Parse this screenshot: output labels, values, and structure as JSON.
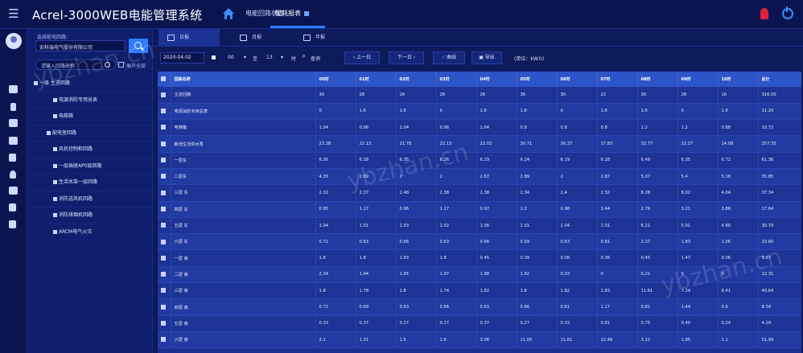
{
  "header": {
    "app_title": "Acrel-3000WEB电能管理系统",
    "tabs": [
      {
        "label": "电能回路状态"
      },
      {
        "label": "能耗报表"
      }
    ]
  },
  "sidebar_icons": [
    "avatar",
    "monitor-icon",
    "gauge-icon",
    "folder-icon",
    "chart-icon",
    "document-icon",
    "user-icon",
    "tools-icon",
    "edit-icon",
    "settings-icon"
  ],
  "tree": {
    "select_label": "选择配电回路：",
    "select_value": "安科瑞电气股份有限公司",
    "name_placeholder": "请输入回路名称",
    "check_label": "展开全部",
    "items": [
      {
        "label": "一级 主进回路"
      },
      {
        "label": "电源消防专用总表"
      },
      {
        "label": "电梯箱"
      },
      {
        "label": "配电室回路"
      },
      {
        "label": "风机控制柜回路"
      },
      {
        "label": "一层插座AP0层回路"
      },
      {
        "label": "生活水泵一层回路"
      },
      {
        "label": "消防送风机回路"
      },
      {
        "label": "消防排烟机回路"
      },
      {
        "label": "ARCM电气火灾"
      }
    ]
  },
  "subtabs": [
    {
      "label": "日报"
    },
    {
      "label": "月报"
    },
    {
      "label": "年报"
    }
  ],
  "toolbar": {
    "date": "2020-04-02",
    "hour_from": "00",
    "hour_to": "13",
    "hour_unit": "时",
    "to_label": "至",
    "query_label": "查询",
    "prev_label": "上一日",
    "next_label": "下一日",
    "chart_label": "曲线",
    "export_label": "导出",
    "unit_label": "(单位：kW.h)"
  },
  "table": {
    "headers": [
      "回路名称",
      "00时",
      "01时",
      "02时",
      "03时",
      "04时",
      "05时",
      "06时",
      "07时",
      "08时",
      "09时",
      "10时",
      "总计"
    ],
    "rows": [
      [
        "主进回路",
        "30",
        "28",
        "26",
        "28",
        "26",
        "36",
        "30",
        "22",
        "30",
        "28",
        "16",
        "316.00"
      ],
      [
        "电源消防专用总表",
        "0",
        "1.6",
        "1.6",
        "0",
        "1.6",
        "1.6",
        "0",
        "1.6",
        "1.6",
        "0",
        "1.6",
        "11.20"
      ],
      [
        "电梯箱",
        "1.04",
        "0.96",
        "1.04",
        "0.96",
        "1.04",
        "0.8",
        "0.8",
        "0.8",
        "1.2",
        "1.2",
        "0.88",
        "10.72"
      ],
      [
        "新增生活供水泵",
        "23.38",
        "22.13",
        "21.78",
        "22.13",
        "22.02",
        "30.71",
        "26.37",
        "17.83",
        "32.77",
        "22.27",
        "14.08",
        "257.35"
      ],
      [
        "一层东",
        "6.36",
        "6.38",
        "6.35",
        "6.26",
        "6.29",
        "6.24",
        "6.19",
        "6.28",
        "6.49",
        "6.35",
        "6.72",
        "61.36"
      ],
      [
        "二层东",
        "4.35",
        "2.69",
        "2",
        "2",
        "2.67",
        "2.89",
        "2",
        "2.87",
        "5.07",
        "5.4",
        "5.16",
        "35.85"
      ],
      [
        "三层 东",
        "2.32",
        "2.37",
        "2.48",
        "2.38",
        "2.38",
        "2.34",
        "2.4",
        "2.32",
        "8.28",
        "8.02",
        "4.04",
        "37.34"
      ],
      [
        "四层 东",
        "0.95",
        "1.17",
        "0.96",
        "1.17",
        "0.97",
        "1.2",
        "0.98",
        "1.44",
        "2.79",
        "3.21",
        "3.86",
        "17.64"
      ],
      [
        "五层 东",
        "1.04",
        "1.01",
        "1.03",
        "1.02",
        "1.06",
        "1.01",
        "1.04",
        "1.01",
        "6.21",
        "5.91",
        "4.80",
        "30.79"
      ],
      [
        "六层 东",
        "0.72",
        "0.63",
        "0.66",
        "0.63",
        "0.66",
        "0.59",
        "0.63",
        "0.81",
        "2.37",
        "1.83",
        "1.06",
        "10.60"
      ],
      [
        "一层 南",
        "1.8",
        "1.8",
        "1.83",
        "1.8",
        "0.45",
        "0.39",
        "0.06",
        "0.36",
        "0.45",
        "1.47",
        "0.06",
        "9.87"
      ],
      [
        "二层 南",
        "2.34",
        "1.94",
        "1.95",
        "1.97",
        "1.98",
        "1.92",
        "0.33",
        "0",
        "0.21",
        "0",
        "0",
        "12.31"
      ],
      [
        "三层 南",
        "1.8",
        "1.78",
        "1.8",
        "1.74",
        "1.82",
        "1.8",
        "1.82",
        "1.83",
        "11.61",
        "7.24",
        "8.41",
        "40.64"
      ],
      [
        "四层 南",
        "0.72",
        "0.69",
        "0.63",
        "0.66",
        "0.63",
        "0.66",
        "0.61",
        "1.17",
        "0.81",
        "1.44",
        "0.6",
        "8.34"
      ],
      [
        "五层 南",
        "0.33",
        "0.37",
        "0.27",
        "0.27",
        "0.37",
        "0.27",
        "0.33",
        "0.81",
        "0.75",
        "0.40",
        "0.24",
        "4.29"
      ],
      [
        "六层 南",
        "2.1",
        "1.31",
        "1.5",
        "1.6",
        "3.06",
        "11.05",
        "11.61",
        "12.49",
        "3.12",
        "1.95",
        "1.1",
        "51.99"
      ]
    ]
  },
  "watermark": "ybzhan.cn"
}
